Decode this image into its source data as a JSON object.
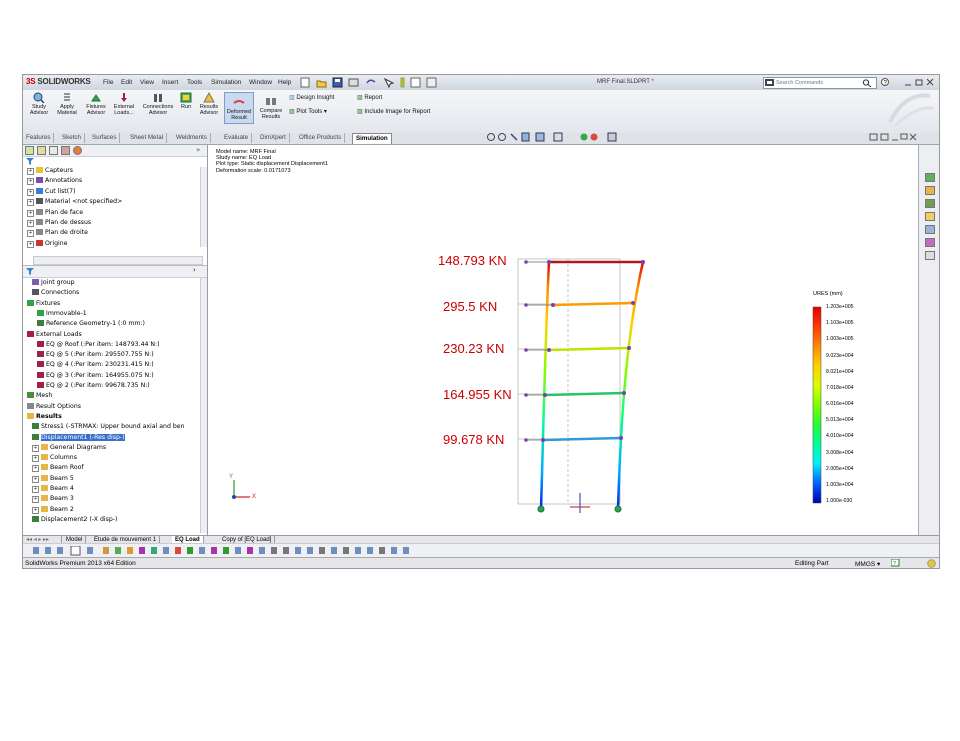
{
  "app": {
    "logo_brand": "SOLIDWORKS",
    "logo_prefix": "3S",
    "menus": [
      "File",
      "Edit",
      "View",
      "Insert",
      "Tools",
      "Simulation",
      "Window",
      "Help"
    ],
    "document_title": "MRF Final.SLDPRT *",
    "search_placeholder": "Search Commands"
  },
  "ribbon": {
    "buttons": [
      {
        "label1": "Study",
        "label2": "Advisor"
      },
      {
        "label1": "Apply",
        "label2": "Material"
      },
      {
        "label1": "Fixtures",
        "label2": "Advisor"
      },
      {
        "label1": "External",
        "label2": "Loads..."
      },
      {
        "label1": "Connections",
        "label2": "Advisor"
      },
      {
        "label1": "Run",
        "label2": ""
      },
      {
        "label1": "Results",
        "label2": "Advisor"
      },
      {
        "label1": "Deformed",
        "label2": "Result"
      },
      {
        "label1": "Compare",
        "label2": "Results"
      }
    ],
    "design_insight": "Design Insight",
    "plot_tools": "Plot Tools",
    "report": "Report",
    "include_image": "Include Image for Report"
  },
  "command_tabs": [
    "Features",
    "Sketch",
    "Surfaces",
    "Sheet Metal",
    "Weldments",
    "Evaluate",
    "DimXpert",
    "Office Products",
    "Simulation"
  ],
  "active_tab": "Simulation",
  "feature_tree": [
    {
      "label": "Capteurs",
      "indent": 0
    },
    {
      "label": "Annotations",
      "indent": 0
    },
    {
      "label": "Cut list(7)",
      "indent": 0
    },
    {
      "label": "Material <not specified>",
      "indent": 0
    },
    {
      "label": "Plan de face",
      "indent": 0
    },
    {
      "label": "Plan de dessus",
      "indent": 0
    },
    {
      "label": "Plan de droite",
      "indent": 0
    },
    {
      "label": "Origine",
      "indent": 0
    }
  ],
  "sim_tree": [
    {
      "label": "Joint group",
      "indent": 1
    },
    {
      "label": "Connections",
      "indent": 1
    },
    {
      "label": "Fixtures",
      "indent": 0
    },
    {
      "label": "Immovable-1",
      "indent": 2
    },
    {
      "label": "Reference Geometry-1 (:0 mm:)",
      "indent": 2
    },
    {
      "label": "External Loads",
      "indent": 0
    },
    {
      "label": "EQ @ Roof (:Per item: 148793.44 N:)",
      "indent": 2
    },
    {
      "label": "EQ @ 5 (:Per item: 295507.755 N:)",
      "indent": 2
    },
    {
      "label": "EQ @ 4 (:Per item: 230231.415 N:)",
      "indent": 2
    },
    {
      "label": "EQ @ 3 (:Per item: 164955.075 N:)",
      "indent": 2
    },
    {
      "label": "EQ @ 2 (:Per item: 99678.735 N:)",
      "indent": 2
    },
    {
      "label": "Mesh",
      "indent": 0
    },
    {
      "label": "Result Options",
      "indent": 0
    },
    {
      "label": "Results",
      "indent": 0
    },
    {
      "label": "Stress1 (-STRMAX: Upper bound axial and ben",
      "indent": 1
    },
    {
      "label": "Displacement1 (-Res disp-)",
      "indent": 1
    },
    {
      "label": "General Diagrams",
      "indent": 1
    },
    {
      "label": "Columns",
      "indent": 1
    },
    {
      "label": "Beam Roof",
      "indent": 1
    },
    {
      "label": "Beam 5",
      "indent": 1
    },
    {
      "label": "Beam 4",
      "indent": 1
    },
    {
      "label": "Beam 3",
      "indent": 1
    },
    {
      "label": "Beam 2",
      "indent": 1
    },
    {
      "label": "Displacement2 (-X disp-)",
      "indent": 1
    }
  ],
  "selected_item": "Displacement1 (-Res disp-)",
  "model_info": {
    "line1": "Model name: MRF Final",
    "line2": "Study name: EQ Load",
    "line3": "Plot type: Static displacement Displacement1",
    "line4": "Deformation scale: 0.0171073"
  },
  "load_labels": [
    "148.793 KN",
    "295.5 KN",
    "230.23 KN",
    "164.955 KN",
    "99.678 KN"
  ],
  "legend": {
    "title": "URES (mm)",
    "values": [
      "1.203e+005",
      "1.103e+005",
      "1.003e+005",
      "9.023e+004",
      "8.021e+004",
      "7.018e+004",
      "6.016e+004",
      "5.013e+004",
      "4.010e+004",
      "3.008e+004",
      "2.005e+004",
      "1.003e+004",
      "1.000e-030"
    ],
    "colors": [
      "#e00000",
      "#ff3c00",
      "#ff8a00",
      "#ffd000",
      "#d8ff00",
      "#7fff00",
      "#20ff30",
      "#00ff9a",
      "#00f0ff",
      "#00a8ff",
      "#0060ff",
      "#0020e8",
      "#0000b0"
    ]
  },
  "bottom_tabs": [
    "Model",
    "Etude de mouvement 1",
    "EQ Load",
    "Copy of [EQ Load]"
  ],
  "active_bottom_tab": "EQ Load",
  "status": {
    "left": "SolidWorks Premium 2013 x64 Edition",
    "editing": "Editing Part",
    "units": "MMGS"
  },
  "axis_labels": {
    "x": "X",
    "y": "Y"
  }
}
